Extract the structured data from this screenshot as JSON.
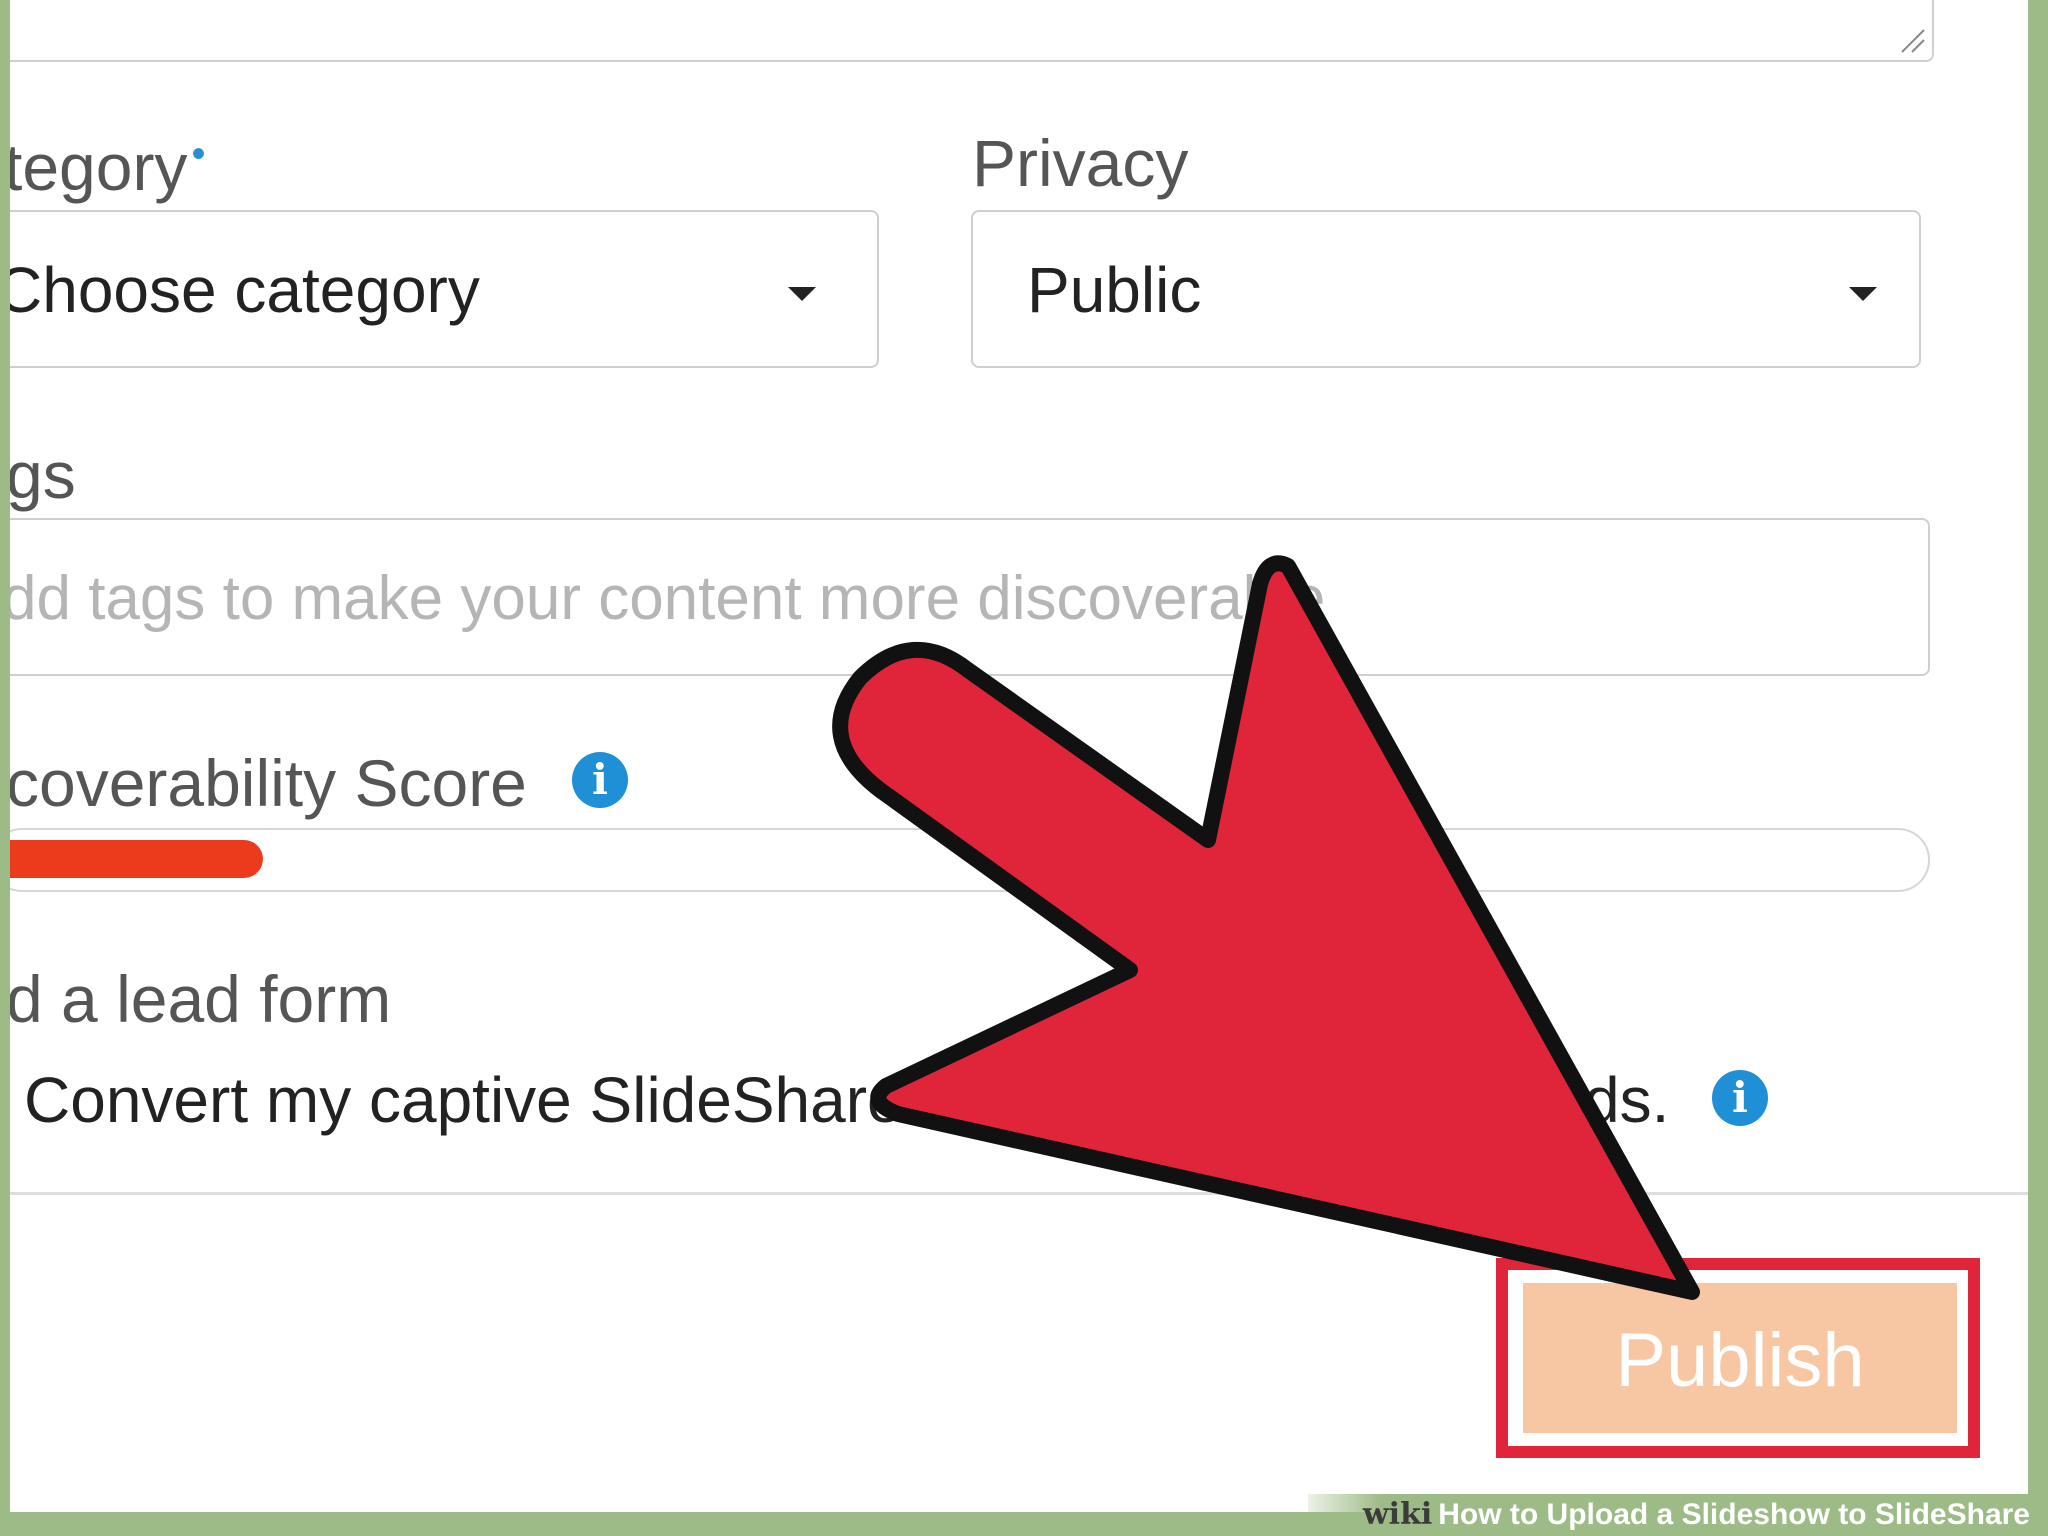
{
  "form": {
    "category": {
      "label": "tegory",
      "required_marker": "•",
      "selected": "Choose category"
    },
    "privacy": {
      "label": "Privacy",
      "selected": "Public"
    },
    "tags": {
      "label": "gs",
      "placeholder": "dd tags to make your content more discoverable"
    },
    "discoverability": {
      "label": "coverability Score",
      "info_icon": "info-icon",
      "score_fraction": 0.14,
      "fill_color": "#ec3b1c"
    },
    "lead_form": {
      "label": "d a lead form",
      "checkbox_text": "Convert my captive SlideShare",
      "checkbox_text_tail": "ds.",
      "info_icon": "info-icon"
    },
    "publish": {
      "label": "Publish",
      "button_color": "#f6c7a2",
      "highlight_color": "#e0253b"
    }
  },
  "annotation": {
    "arrow_color": "#e0253b"
  },
  "watermark": {
    "wiki": "wiki",
    "title": "How to Upload a Slideshow to SlideShare"
  }
}
